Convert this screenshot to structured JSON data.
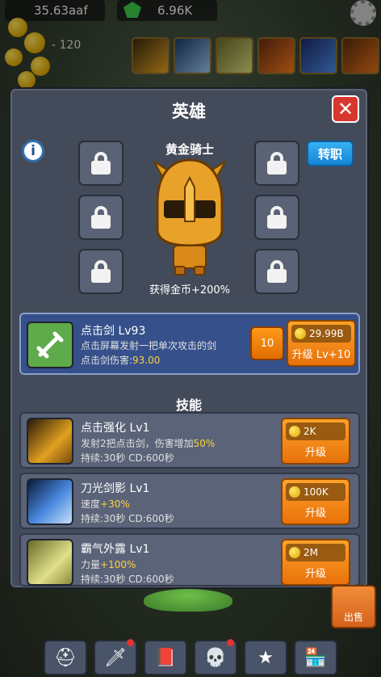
{
  "top": {
    "gold": "35.63aaf",
    "gems": "6.96K",
    "floating_text": "- 120"
  },
  "modal": {
    "title": "英雄",
    "hero_name": "黄金骑士",
    "hero_bonus": "获得金币+200%",
    "transfer_label": "转职",
    "info_icon": "i"
  },
  "weapon": {
    "title": "点击剑 Lv93",
    "desc": "点击屏幕发射一把单次攻击的剑",
    "stat_label": "点击剑伤害:",
    "stat_value": "93.00",
    "level_badge": "10",
    "price": "29.99B",
    "upgrade_label": "升级 Lv+10"
  },
  "skills_header": "技能",
  "skills": [
    {
      "title": "点击强化 Lv1",
      "desc_prefix": "发射2把点击剑，伤害增加",
      "desc_value": "50%",
      "stat": "持续:30秒 CD:600秒",
      "price": "2K",
      "upgrade_label": "升级"
    },
    {
      "title": "刀光剑影 Lv1",
      "desc_prefix": "速度",
      "desc_value": "+30%",
      "stat": "持续:30秒 CD:600秒",
      "price": "100K",
      "upgrade_label": "升级"
    },
    {
      "title": "霸气外露 Lv1",
      "desc_prefix": "力量",
      "desc_value": "+100%",
      "stat": "持续:30秒 CD:600秒",
      "price": "2M",
      "upgrade_label": "升级"
    }
  ],
  "side": {
    "sell_label": "出售"
  },
  "colors": {
    "accent_orange": "#e8720a",
    "accent_blue": "#1684d6",
    "highlight_yellow": "#ffd23a",
    "close_red": "#d8362f"
  },
  "icons": {
    "nav": [
      "helmet-icon",
      "sword-icon",
      "spellbook-icon",
      "crowned-skull-icon",
      "star-icon",
      "shop-icon"
    ]
  }
}
